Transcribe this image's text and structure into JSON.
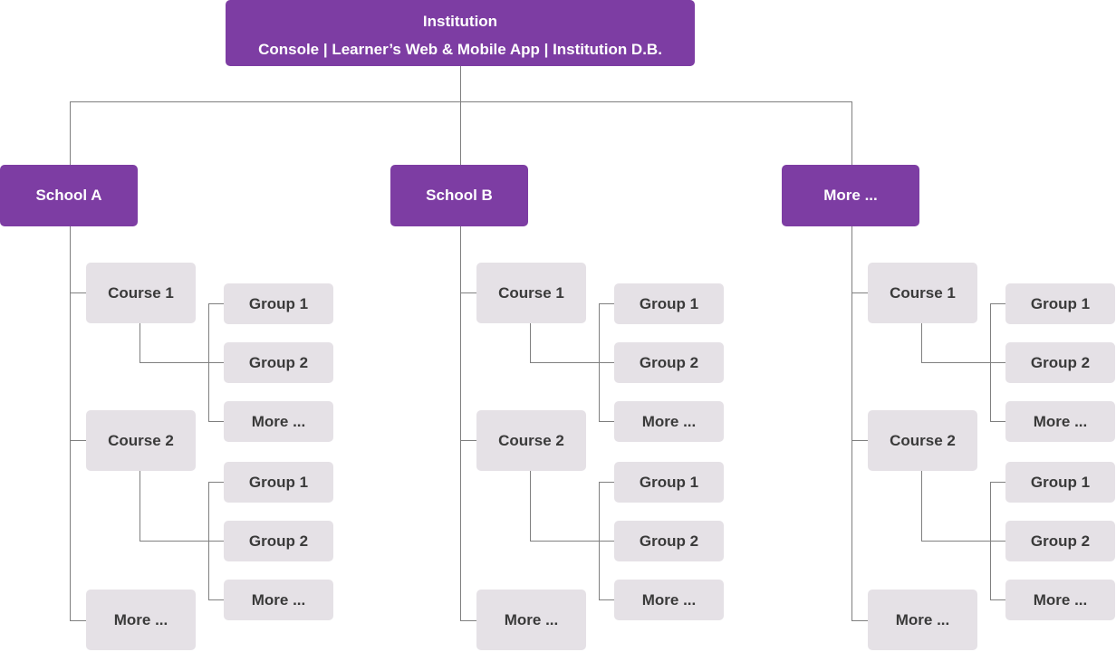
{
  "root": {
    "title": "Institution",
    "subtitle": "Console | Learner’s Web & Mobile App | Institution D.B."
  },
  "colors": {
    "primary": "#7D3DA3",
    "node_bg": "#E5E1E6",
    "node_text": "#3A3A3A",
    "connector": "#7F7F7F"
  },
  "schools": [
    {
      "label": "School A",
      "courses": [
        {
          "label": "Course 1",
          "groups": [
            "Group 1",
            "Group 2",
            "More ..."
          ]
        },
        {
          "label": "Course 2",
          "groups": [
            "Group 1",
            "Group 2",
            "More ..."
          ]
        }
      ],
      "more_label": "More ..."
    },
    {
      "label": "School B",
      "courses": [
        {
          "label": "Course 1",
          "groups": [
            "Group 1",
            "Group 2",
            "More ..."
          ]
        },
        {
          "label": "Course 2",
          "groups": [
            "Group 1",
            "Group 2",
            "More ..."
          ]
        }
      ],
      "more_label": "More ..."
    },
    {
      "label": "More ...",
      "courses": [
        {
          "label": "Course 1",
          "groups": [
            "Group 1",
            "Group 2",
            "More ..."
          ]
        },
        {
          "label": "Course 2",
          "groups": [
            "Group 1",
            "Group 2",
            "More ..."
          ]
        }
      ],
      "more_label": "More ..."
    }
  ]
}
